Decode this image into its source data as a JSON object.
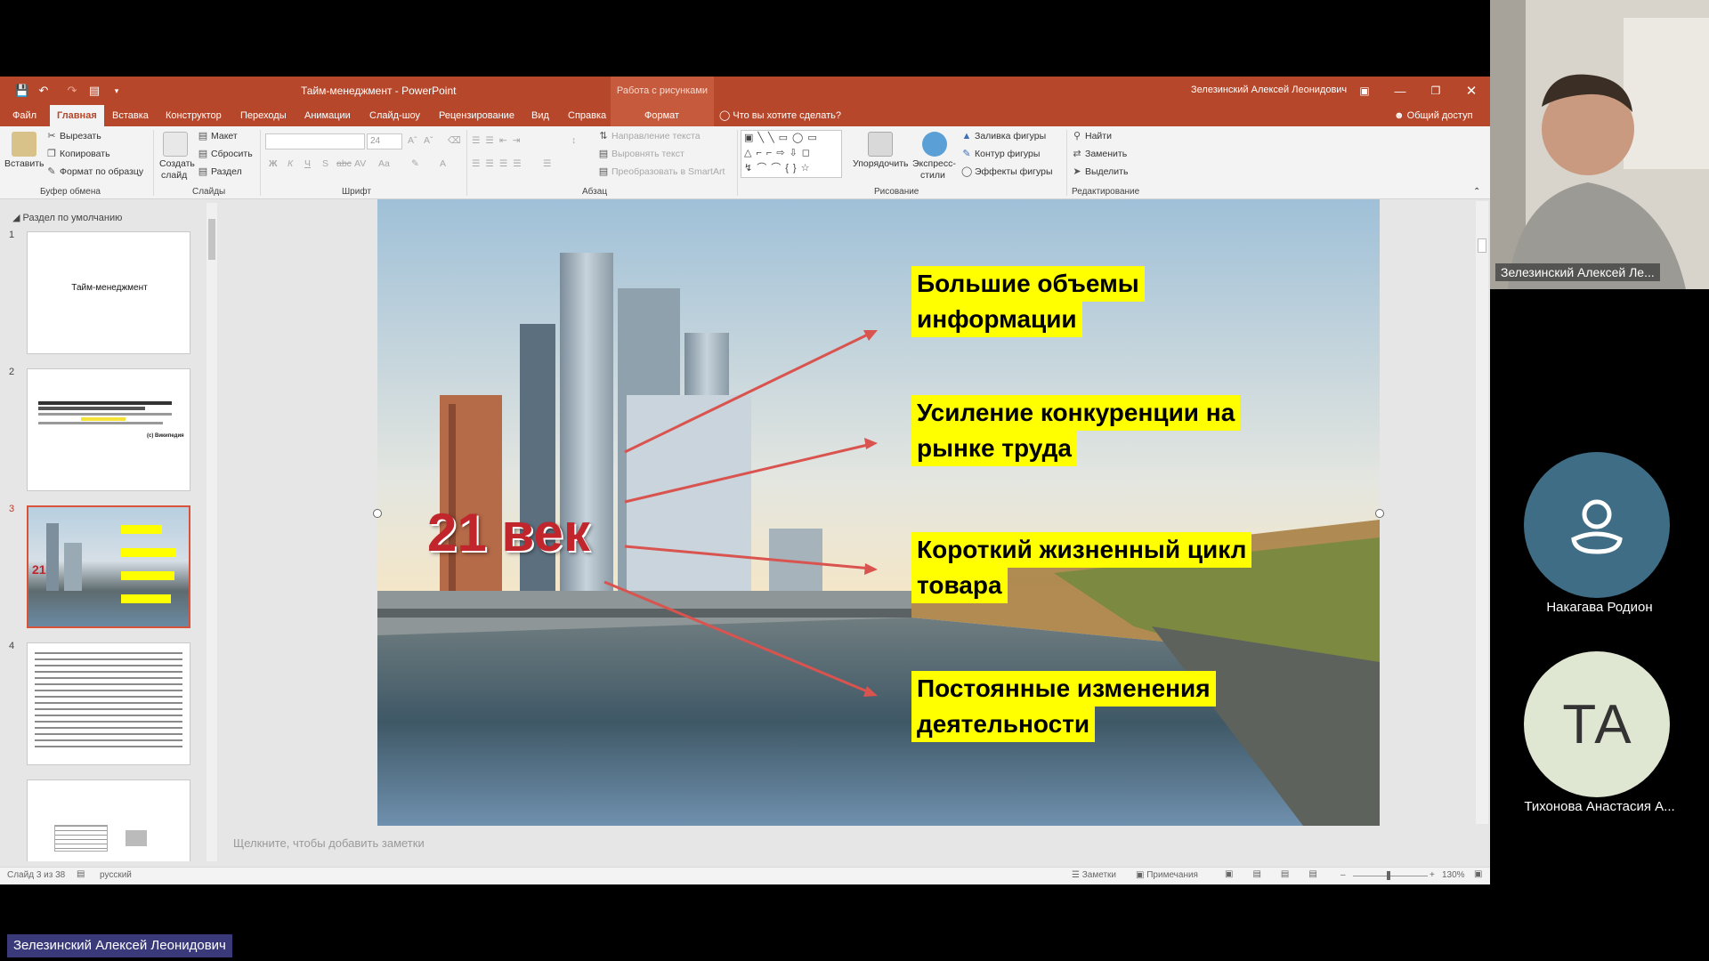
{
  "window": {
    "doc_title": "Тайм-менеджмент - PowerPoint",
    "context_title": "Работа с рисунками",
    "user": "Зелезинский Алексей Леонидович"
  },
  "tabs": {
    "file": "Файл",
    "home": "Главная",
    "insert": "Вставка",
    "design": "Конструктор",
    "transitions": "Переходы",
    "animations": "Анимации",
    "slideshow": "Слайд-шоу",
    "review": "Рецензирование",
    "view": "Вид",
    "help": "Справка",
    "format": "Формат",
    "tell_me": "Что вы хотите сделать?",
    "share": "Общий доступ"
  },
  "ribbon": {
    "clipboard": {
      "paste": "Вставить",
      "cut": "Вырезать",
      "copy": "Копировать",
      "format_painter": "Формат по образцу",
      "label": "Буфер обмена"
    },
    "slides": {
      "new_slide_1": "Создать",
      "new_slide_2": "слайд",
      "layout": "Макет",
      "reset": "Сбросить",
      "section": "Раздел",
      "label": "Слайды"
    },
    "font": {
      "size": "24",
      "label": "Шрифт"
    },
    "paragraph": {
      "text_direction": "Направление текста",
      "align_text": "Выровнять текст",
      "smartart": "Преобразовать в SmartArt",
      "label": "Абзац"
    },
    "drawing": {
      "arrange": "Упорядочить",
      "quick_styles_1": "Экспресс-",
      "quick_styles_2": "стили",
      "shape_fill": "Заливка фигуры",
      "shape_outline": "Контур фигуры",
      "shape_effects": "Эффекты фигуры",
      "label": "Рисование"
    },
    "editing": {
      "find": "Найти",
      "replace": "Заменить",
      "select": "Выделить",
      "label": "Редактирование"
    }
  },
  "left_pane": {
    "section": "Раздел по умолчанию",
    "slide_numbers": [
      "1",
      "2",
      "3",
      "4"
    ],
    "thumb1_title": "Тайм-менеджмент",
    "thumb2_source": "(с) Википедия"
  },
  "slide": {
    "headline": "21 век",
    "points": [
      {
        "line1": "Большие объемы",
        "line2": "информации"
      },
      {
        "line1": "Усиление конкуренции на",
        "line2": "рынке труда"
      },
      {
        "line1": "Короткий жизненный цикл",
        "line2": "товара"
      },
      {
        "line1": "Постоянные изменения",
        "line2": "деятельности"
      }
    ],
    "highlight_color": "#ffff00",
    "headline_color": "#c0262c",
    "arrow_color": "#d9534f"
  },
  "notes_hint": "Щелкните, чтобы добавить заметки",
  "statusbar": {
    "slide_count": "Слайд 3 из 38",
    "language": "русский",
    "notes": "Заметки",
    "comments": "Примечания",
    "zoom": "130%"
  },
  "video": {
    "speaker_tag": "Зелезинский Алексей Ле...",
    "participants": [
      {
        "name": "Накагава Родион",
        "initials": "",
        "color": "#3e6d85"
      },
      {
        "name": "Тихонова Анастасия А...",
        "initials": "ТА",
        "color": "#dfe6d2"
      }
    ],
    "bottom_name": "Зелезинский Алексей Леонидович"
  }
}
